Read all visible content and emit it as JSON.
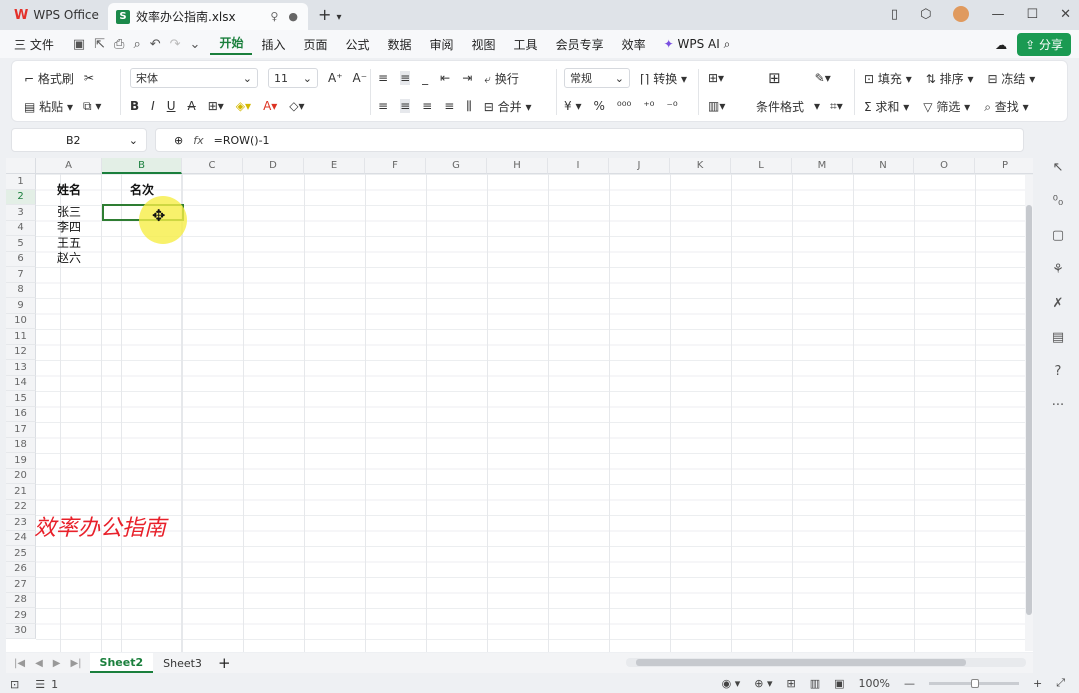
{
  "titlebar": {
    "app_tab": "WPS Office",
    "doc_tab": "效率办公指南.xlsx",
    "new_tab": "+"
  },
  "menu": {
    "file": "三 文件",
    "items": [
      "开始",
      "插入",
      "页面",
      "公式",
      "数据",
      "审阅",
      "视图",
      "工具",
      "会员专享",
      "效率",
      "WPS AI"
    ],
    "active": "开始",
    "share": "分享"
  },
  "ribbon": {
    "format_painter": "格式刷",
    "paste": "粘贴",
    "font": "宋体",
    "font_size": "11",
    "wrap": "换行",
    "merge": "合并",
    "number_format": "常规",
    "convert": "转换",
    "cond_format": "条件格式",
    "fill": "填充",
    "sort": "排序",
    "freeze": "冻结",
    "sum": "求和",
    "filter": "筛选",
    "find": "查找"
  },
  "formula_bar": {
    "name_box": "B2",
    "formula": "=ROW()-1"
  },
  "columns": [
    "A",
    "B",
    "C",
    "D",
    "E",
    "F",
    "G",
    "H",
    "I",
    "J",
    "K",
    "L",
    "M",
    "N",
    "O",
    "P"
  ],
  "rows": [
    "1",
    "2",
    "3",
    "4",
    "5",
    "6",
    "7",
    "8",
    "9",
    "10",
    "11",
    "12",
    "13",
    "14",
    "15",
    "16",
    "17",
    "18",
    "19",
    "20",
    "21",
    "22",
    "23",
    "24",
    "25",
    "26",
    "27",
    "28",
    "29",
    "30"
  ],
  "cells": {
    "A1": "姓名",
    "B1": "名次",
    "A2": "张三",
    "A3": "李四",
    "A4": "王五",
    "A5": "赵六"
  },
  "watermark": "效率办公指南",
  "sheets": [
    "Sheet2",
    "Sheet3"
  ],
  "active_sheet": "Sheet2",
  "status": {
    "page": "1",
    "zoom": "100%"
  },
  "colors": {
    "accent": "#1a7f3c",
    "watermark": "#e8202a",
    "cursor_halo": "#f6ee46"
  }
}
